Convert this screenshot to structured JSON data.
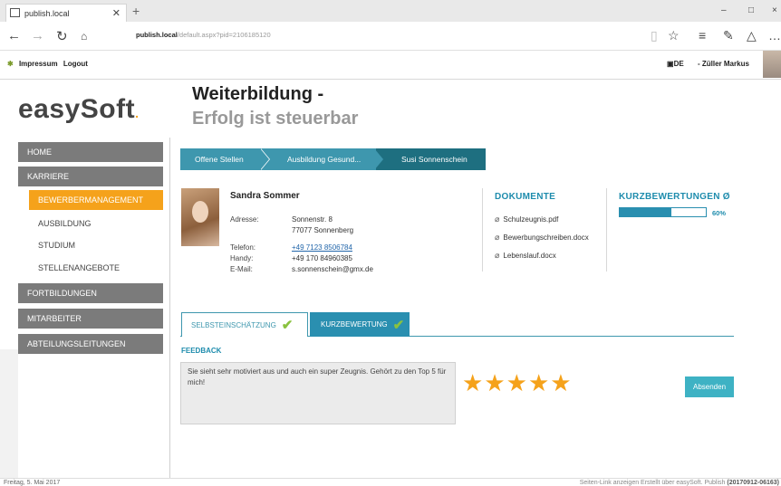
{
  "browser": {
    "tab_title": "publish.local",
    "new_tab": "+",
    "address_host": "publish.local",
    "address_path": "/default.aspx?pid=2106185120",
    "win_min": "–",
    "win_max": "□",
    "win_close": "×"
  },
  "topbar": {
    "impressum": "Impressum",
    "logout": "Logout",
    "lang": "DE",
    "user": "- Züller Markus"
  },
  "logo": {
    "text": "easySoft",
    "dot": "."
  },
  "heading": {
    "line1": "Weiterbildung -",
    "line2": "Erfolg ist steuerbar"
  },
  "sidebar": {
    "home": "HOME",
    "karriere": "KARRIERE",
    "bewerber": "BEWERBERMANAGEMENT",
    "ausbildung": "AUSBILDUNG",
    "studium": "STUDIUM",
    "stellen": "STELLENANGEBOTE",
    "fortbildungen": "FORTBILDUNGEN",
    "mitarbeiter": "MITARBEITER",
    "abteilung": "ABTEILUNGSLEITUNGEN"
  },
  "breadcrumb": {
    "item1": "Offene Stellen",
    "item2": "Ausbildung Gesund...",
    "item3": "Susi Sonnenschein"
  },
  "profile": {
    "name": "Sandra Sommer",
    "address_label": "Adresse:",
    "address_line1": "Sonnenstr. 8",
    "address_line2": "77077 Sonnenberg",
    "phone_label": "Telefon:",
    "phone": "+49 7123 8506784",
    "mobile_label": "Handy:",
    "mobile": "+49 170 84960385",
    "email_label": "E-Mail:",
    "email": "s.sonnenschein@gmx.de"
  },
  "documents": {
    "heading": "DOKUMENTE",
    "items": [
      "Schulzeugnis.pdf",
      "Bewerbungschreiben.docx",
      "Lebenslauf.docx"
    ]
  },
  "ratings": {
    "heading": "KURZBEWERTUNGEN Ø",
    "percent_label": "60%",
    "progress": 0.6
  },
  "tabs": {
    "tab1": "SELBSTEINSCHÄTZUNG",
    "tab2": "KURZBEWERTUNG"
  },
  "feedback": {
    "heading": "FEEDBACK",
    "text": "Sie sieht sehr motiviert aus und auch ein super Zeugnis. Gehört zu den Top 5 für mich!",
    "stars": 5,
    "send_label": "Absenden"
  },
  "footer": {
    "date": "Freitag, 5. Mai 2017",
    "right": "Seiten-Link anzeigen  Erstellt über easySoft. Publish",
    "version": "(20170912-06163)"
  }
}
